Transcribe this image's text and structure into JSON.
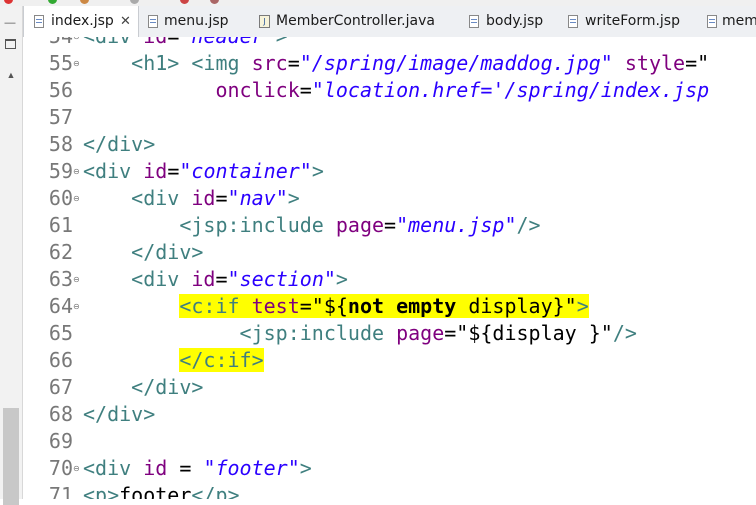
{
  "tabs": [
    {
      "label": "index.jsp",
      "close": "✕",
      "active": true,
      "kind": "jsp"
    },
    {
      "label": "menu.jsp",
      "kind": "jsp"
    },
    {
      "label": "MemberController.java",
      "kind": "java"
    },
    {
      "label": "body.jsp",
      "kind": "jsp"
    },
    {
      "label": "writeForm.jsp",
      "kind": "jsp"
    },
    {
      "label": "mem",
      "kind": "jsp"
    }
  ],
  "java_icon_letter": "J",
  "colors": {
    "tag": "#3f7f7f",
    "attr": "#7f007f",
    "string": "#2a00ff",
    "highlight": "#ffff00",
    "line_number": "#787878"
  },
  "lines": [
    {
      "n": "54",
      "fold": true,
      "parts": [
        {
          "c": "tag",
          "t": "<div "
        },
        {
          "c": "attr",
          "t": "id"
        },
        {
          "c": "plain",
          "t": "="
        },
        {
          "c": "str",
          "t": "\"header\""
        },
        {
          "c": "tag",
          "t": ">"
        }
      ]
    },
    {
      "n": "55",
      "fold": true,
      "parts": [
        {
          "c": "plain",
          "t": "    "
        },
        {
          "c": "tag",
          "t": "<h1> <img "
        },
        {
          "c": "attr",
          "t": "src"
        },
        {
          "c": "plain",
          "t": "="
        },
        {
          "c": "str",
          "t": "\"/spring/image/maddog.jpg\""
        },
        {
          "c": "plain",
          "t": " "
        },
        {
          "c": "attr",
          "t": "style"
        },
        {
          "c": "plain",
          "t": "=\""
        }
      ]
    },
    {
      "n": "56",
      "parts": [
        {
          "c": "plain",
          "t": "           "
        },
        {
          "c": "attr",
          "t": "onclick"
        },
        {
          "c": "plain",
          "t": "="
        },
        {
          "c": "str",
          "t": "\"location.href='/spring/index.jsp"
        }
      ]
    },
    {
      "n": "57",
      "parts": []
    },
    {
      "n": "58",
      "parts": [
        {
          "c": "tag",
          "t": "</div>"
        }
      ]
    },
    {
      "n": "59",
      "fold": true,
      "parts": [
        {
          "c": "tag",
          "t": "<div "
        },
        {
          "c": "attr",
          "t": "id"
        },
        {
          "c": "plain",
          "t": "="
        },
        {
          "c": "str",
          "t": "\"container\""
        },
        {
          "c": "tag",
          "t": ">"
        }
      ]
    },
    {
      "n": "60",
      "fold": true,
      "parts": [
        {
          "c": "plain",
          "t": "    "
        },
        {
          "c": "tag",
          "t": "<div "
        },
        {
          "c": "attr",
          "t": "id"
        },
        {
          "c": "plain",
          "t": "="
        },
        {
          "c": "str",
          "t": "\"nav\""
        },
        {
          "c": "tag",
          "t": ">"
        }
      ]
    },
    {
      "n": "61",
      "parts": [
        {
          "c": "plain",
          "t": "        "
        },
        {
          "c": "tag",
          "t": "<jsp:include "
        },
        {
          "c": "attr",
          "t": "page"
        },
        {
          "c": "plain",
          "t": "="
        },
        {
          "c": "str",
          "t": "\"menu.jsp\""
        },
        {
          "c": "tag",
          "t": "/>"
        }
      ]
    },
    {
      "n": "62",
      "parts": [
        {
          "c": "plain",
          "t": "    "
        },
        {
          "c": "tag",
          "t": "</div>"
        }
      ]
    },
    {
      "n": "63",
      "fold": true,
      "parts": [
        {
          "c": "plain",
          "t": "    "
        },
        {
          "c": "tag",
          "t": "<div "
        },
        {
          "c": "attr",
          "t": "id"
        },
        {
          "c": "plain",
          "t": "="
        },
        {
          "c": "str",
          "t": "\"section\""
        },
        {
          "c": "tag",
          "t": ">"
        }
      ]
    },
    {
      "n": "64",
      "fold": true,
      "parts": [
        {
          "c": "plain",
          "t": "        "
        },
        {
          "c": "tag",
          "t": "<c:if ",
          "hl": true
        },
        {
          "c": "attr",
          "t": "test",
          "hl": true
        },
        {
          "c": "plain",
          "t": "=\"${",
          "hl": true
        },
        {
          "c": "bold",
          "t": "not empty",
          "hl": true
        },
        {
          "c": "plain",
          "t": " display}\"",
          "hl": true
        },
        {
          "c": "tag",
          "t": ">",
          "hl": true
        }
      ]
    },
    {
      "n": "65",
      "parts": [
        {
          "c": "plain",
          "t": "             "
        },
        {
          "c": "tag",
          "t": "<jsp:include "
        },
        {
          "c": "attr",
          "t": "page"
        },
        {
          "c": "plain",
          "t": "=\"${display }\""
        },
        {
          "c": "tag",
          "t": "/>"
        }
      ]
    },
    {
      "n": "66",
      "parts": [
        {
          "c": "plain",
          "t": "        "
        },
        {
          "c": "tag",
          "t": "</c:if>",
          "hl": true
        }
      ]
    },
    {
      "n": "67",
      "parts": [
        {
          "c": "plain",
          "t": "    "
        },
        {
          "c": "tag",
          "t": "</div>"
        }
      ]
    },
    {
      "n": "68",
      "parts": [
        {
          "c": "tag",
          "t": "</div>"
        }
      ]
    },
    {
      "n": "69",
      "parts": []
    },
    {
      "n": "70",
      "fold": true,
      "parts": [
        {
          "c": "tag",
          "t": "<div "
        },
        {
          "c": "attr",
          "t": "id"
        },
        {
          "c": "plain",
          "t": " = "
        },
        {
          "c": "str",
          "t": "\"footer\""
        },
        {
          "c": "tag",
          "t": ">"
        }
      ]
    },
    {
      "n": "71",
      "parts": [
        {
          "c": "tag",
          "t": "<p>"
        },
        {
          "c": "plain",
          "t": "footer"
        },
        {
          "c": "tag",
          "t": "</p>"
        }
      ]
    }
  ]
}
